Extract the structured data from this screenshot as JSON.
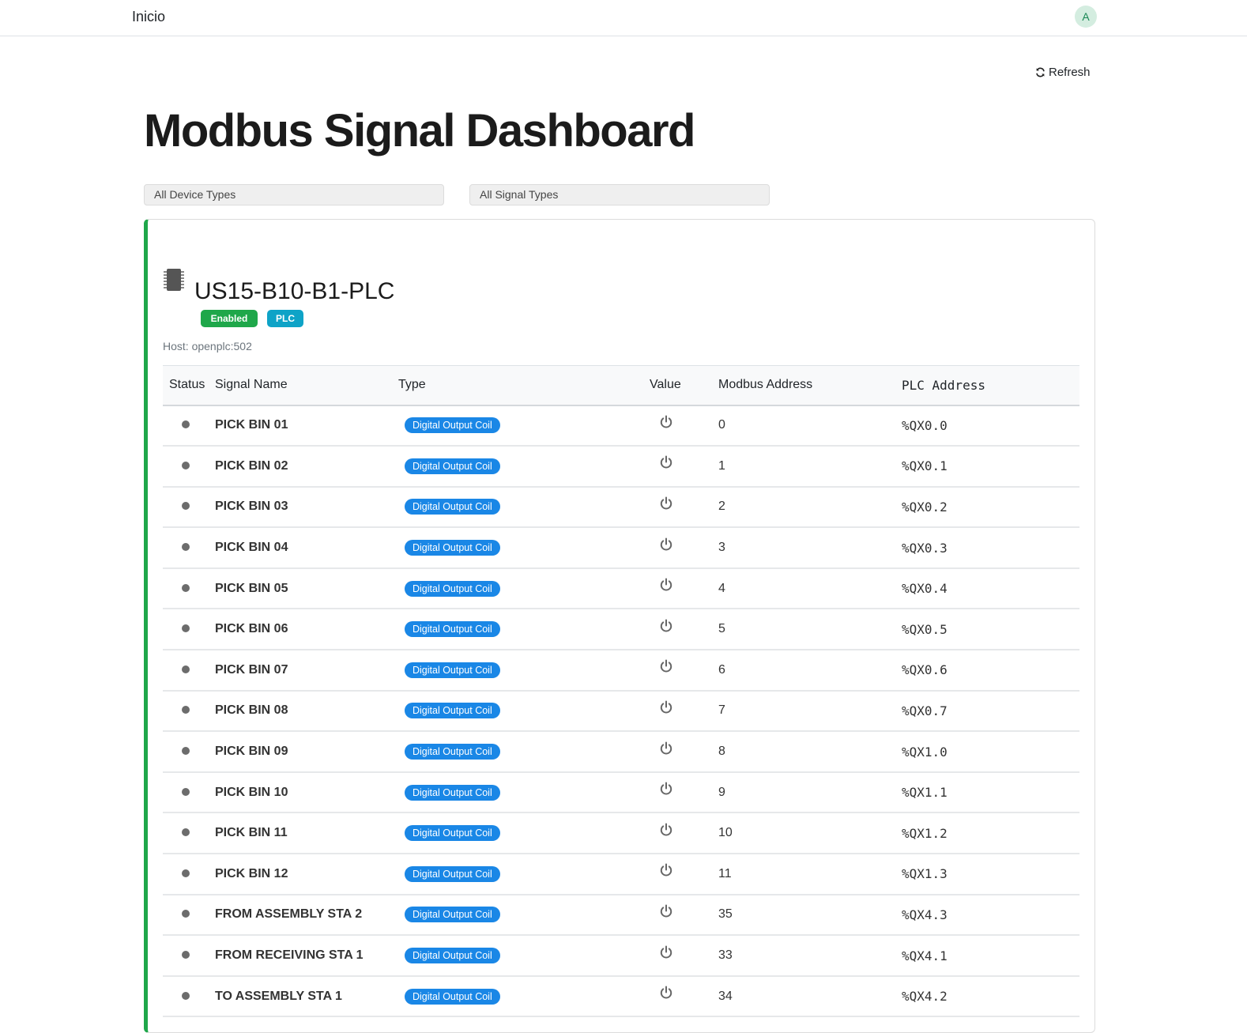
{
  "nav": {
    "brand": "Inicio",
    "avatar_initial": "A"
  },
  "toolbar": {
    "refresh_label": "Refresh",
    "refresh_icon": "refresh-icon"
  },
  "page": {
    "title": "Modbus Signal Dashboard"
  },
  "filters": {
    "device_type": "All Device Types",
    "signal_type": "All Signal Types"
  },
  "device": {
    "name": "US15-B10-B1-PLC",
    "icon": "chip-icon",
    "status_badge": "Enabled",
    "type_badge": "PLC",
    "host": "Host: openplc:502",
    "accent_color": "#1fa74a"
  },
  "table": {
    "headers": [
      "Status",
      "Signal Name",
      "Type",
      "Value",
      "Modbus Address",
      "PLC Address"
    ],
    "rows": [
      {
        "name": "PICK BIN 01",
        "type": "Digital Output Coil",
        "modbus": "0",
        "plc": "%QX0.0"
      },
      {
        "name": "PICK BIN 02",
        "type": "Digital Output Coil",
        "modbus": "1",
        "plc": "%QX0.1"
      },
      {
        "name": "PICK BIN 03",
        "type": "Digital Output Coil",
        "modbus": "2",
        "plc": "%QX0.2"
      },
      {
        "name": "PICK BIN 04",
        "type": "Digital Output Coil",
        "modbus": "3",
        "plc": "%QX0.3"
      },
      {
        "name": "PICK BIN 05",
        "type": "Digital Output Coil",
        "modbus": "4",
        "plc": "%QX0.4"
      },
      {
        "name": "PICK BIN 06",
        "type": "Digital Output Coil",
        "modbus": "5",
        "plc": "%QX0.5"
      },
      {
        "name": "PICK BIN 07",
        "type": "Digital Output Coil",
        "modbus": "6",
        "plc": "%QX0.6"
      },
      {
        "name": "PICK BIN 08",
        "type": "Digital Output Coil",
        "modbus": "7",
        "plc": "%QX0.7"
      },
      {
        "name": "PICK BIN 09",
        "type": "Digital Output Coil",
        "modbus": "8",
        "plc": "%QX1.0"
      },
      {
        "name": "PICK BIN 10",
        "type": "Digital Output Coil",
        "modbus": "9",
        "plc": "%QX1.1"
      },
      {
        "name": "PICK BIN 11",
        "type": "Digital Output Coil",
        "modbus": "10",
        "plc": "%QX1.2"
      },
      {
        "name": "PICK BIN 12",
        "type": "Digital Output Coil",
        "modbus": "11",
        "plc": "%QX1.3"
      },
      {
        "name": "FROM ASSEMBLY STA 2",
        "type": "Digital Output Coil",
        "modbus": "35",
        "plc": "%QX4.3"
      },
      {
        "name": "FROM RECEIVING STA 1",
        "type": "Digital Output Coil",
        "modbus": "33",
        "plc": "%QX4.1"
      },
      {
        "name": "TO ASSEMBLY STA 1",
        "type": "Digital Output Coil",
        "modbus": "34",
        "plc": "%QX4.2"
      }
    ]
  },
  "colors": {
    "type_badge": "#1a87e6",
    "status_dot": "#6c6c6c",
    "plc_badge": "#0ea3c7"
  }
}
